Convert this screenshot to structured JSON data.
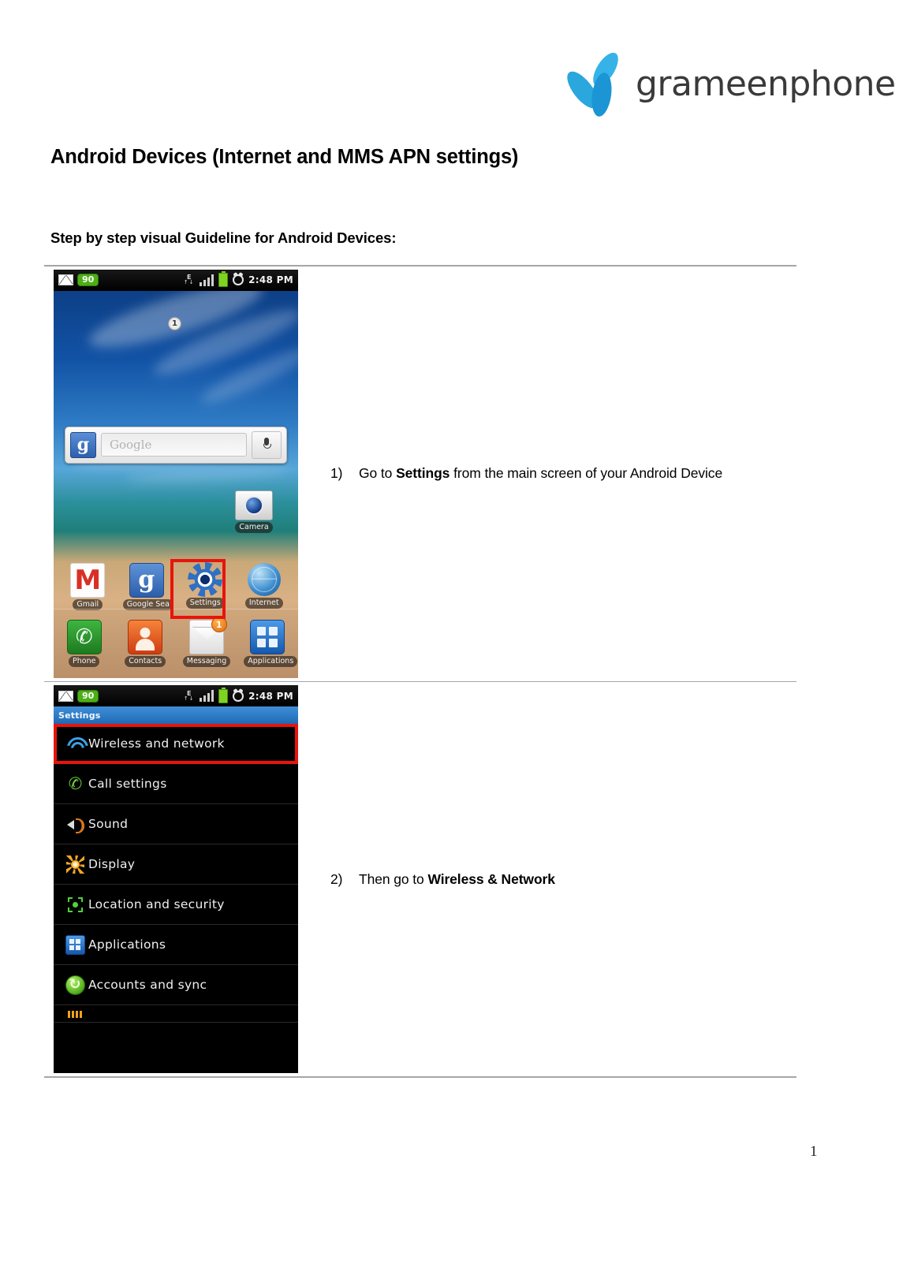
{
  "brand": {
    "logo_text": "grameenphone",
    "logo_mark_name": "telenor-propeller-logo",
    "logo_color": "#1a9fd9"
  },
  "document": {
    "title": "Android Devices (Internet and MMS APN settings)",
    "subtitle": "Step by step visual Guideline for Android Devices:",
    "page_number": "1"
  },
  "steps": [
    {
      "number": "1)",
      "text_before": "Go to ",
      "text_bold": "Settings",
      "text_after": " from the main screen of your Android Device",
      "screen": "home"
    },
    {
      "number": "2)",
      "text_before": "Then go to ",
      "text_bold": "Wireless & Network",
      "text_after": "",
      "screen": "settings"
    }
  ],
  "phone_home": {
    "statusbar": {
      "mail_badge": "90",
      "network_type": "E",
      "time": "2:48 PM"
    },
    "page_indicator": "1",
    "search_widget": {
      "logo": "g",
      "placeholder": "Google",
      "mic": "microphone-icon"
    },
    "camera_app": {
      "label": "Camera"
    },
    "apps_row": [
      {
        "label": "Gmail",
        "icon": "gmail-icon"
      },
      {
        "label": "Google Sea",
        "icon": "google-search-icon"
      },
      {
        "label": "Settings",
        "icon": "settings-gear-icon",
        "highlighted": true
      },
      {
        "label": "Internet",
        "icon": "internet-globe-icon"
      }
    ],
    "dock": [
      {
        "label": "Phone",
        "icon": "phone-handset-icon"
      },
      {
        "label": "Contacts",
        "icon": "contacts-person-icon"
      },
      {
        "label": "Messaging",
        "icon": "messaging-envelope-icon",
        "badge": "1"
      },
      {
        "label": "Applications",
        "icon": "applications-grid-icon"
      }
    ]
  },
  "phone_settings": {
    "statusbar": {
      "mail_badge": "90",
      "network_type": "E",
      "time": "2:48 PM"
    },
    "title": "Settings",
    "items": [
      {
        "label": "Wireless and network",
        "icon": "wifi-icon",
        "highlighted": true
      },
      {
        "label": "Call settings",
        "icon": "call-handset-icon",
        "highlighted": false
      },
      {
        "label": "Sound",
        "icon": "speaker-sound-icon",
        "highlighted": false
      },
      {
        "label": "Display",
        "icon": "brightness-display-icon",
        "highlighted": false
      },
      {
        "label": "Location and security",
        "icon": "location-security-icon",
        "highlighted": false
      },
      {
        "label": "Applications",
        "icon": "applications-grid-icon",
        "highlighted": false
      },
      {
        "label": "Accounts and sync",
        "icon": "sync-refresh-icon",
        "highlighted": false
      },
      {
        "label": "",
        "icon": "privacy-icon",
        "highlighted": false,
        "clipped": true
      }
    ]
  }
}
